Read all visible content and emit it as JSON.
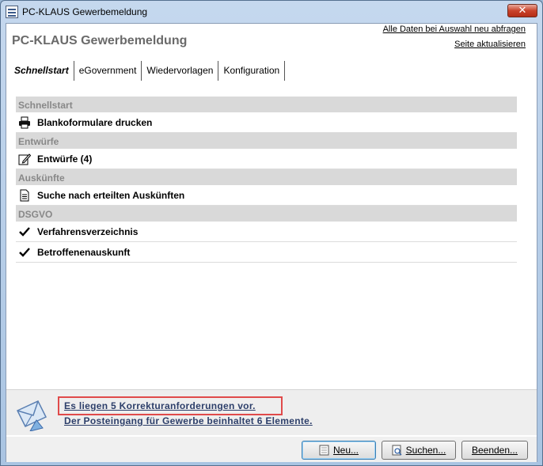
{
  "window": {
    "title": "PC-KLAUS Gewerbemeldung",
    "close_label": "✕"
  },
  "header": {
    "page_title": "PC-KLAUS Gewerbemeldung",
    "link_refresh_all": "Alle Daten bei Auswahl neu abfragen",
    "link_reload_page": "Seite aktualisieren"
  },
  "tabs": [
    {
      "label": "Schnellstart",
      "active": true
    },
    {
      "label": "eGovernment",
      "active": false
    },
    {
      "label": "Wiedervorlagen",
      "active": false
    },
    {
      "label": "Konfiguration",
      "active": false
    }
  ],
  "sections": [
    {
      "title": "Schnellstart",
      "items": [
        {
          "label": "Blankoformulare drucken",
          "icon": "printer-icon"
        }
      ]
    },
    {
      "title": "Entwürfe",
      "items": [
        {
          "label": "Entwürfe (4)",
          "icon": "edit-icon"
        }
      ]
    },
    {
      "title": "Auskünfte",
      "items": [
        {
          "label": "Suche nach erteilten Auskünften",
          "icon": "document-icon"
        }
      ]
    },
    {
      "title": "DSGVO",
      "items": [
        {
          "label": "Verfahrensverzeichnis",
          "icon": "checkmark-icon"
        },
        {
          "label": "Betroffenenauskunft",
          "icon": "checkmark-icon"
        }
      ]
    }
  ],
  "notices": {
    "corrections": "Es liegen 5 Korrekturanforderungen vor.",
    "inbox": "Der Posteingang für Gewerbe beinhaltet 6 Elemente."
  },
  "buttons": {
    "new": "Neu...",
    "search": "Suchen...",
    "exit": "Beenden..."
  },
  "colors": {
    "highlight_border": "#e04a4a",
    "section_header_bg": "#d9d9d9",
    "notice_link": "#2d3f6a"
  }
}
